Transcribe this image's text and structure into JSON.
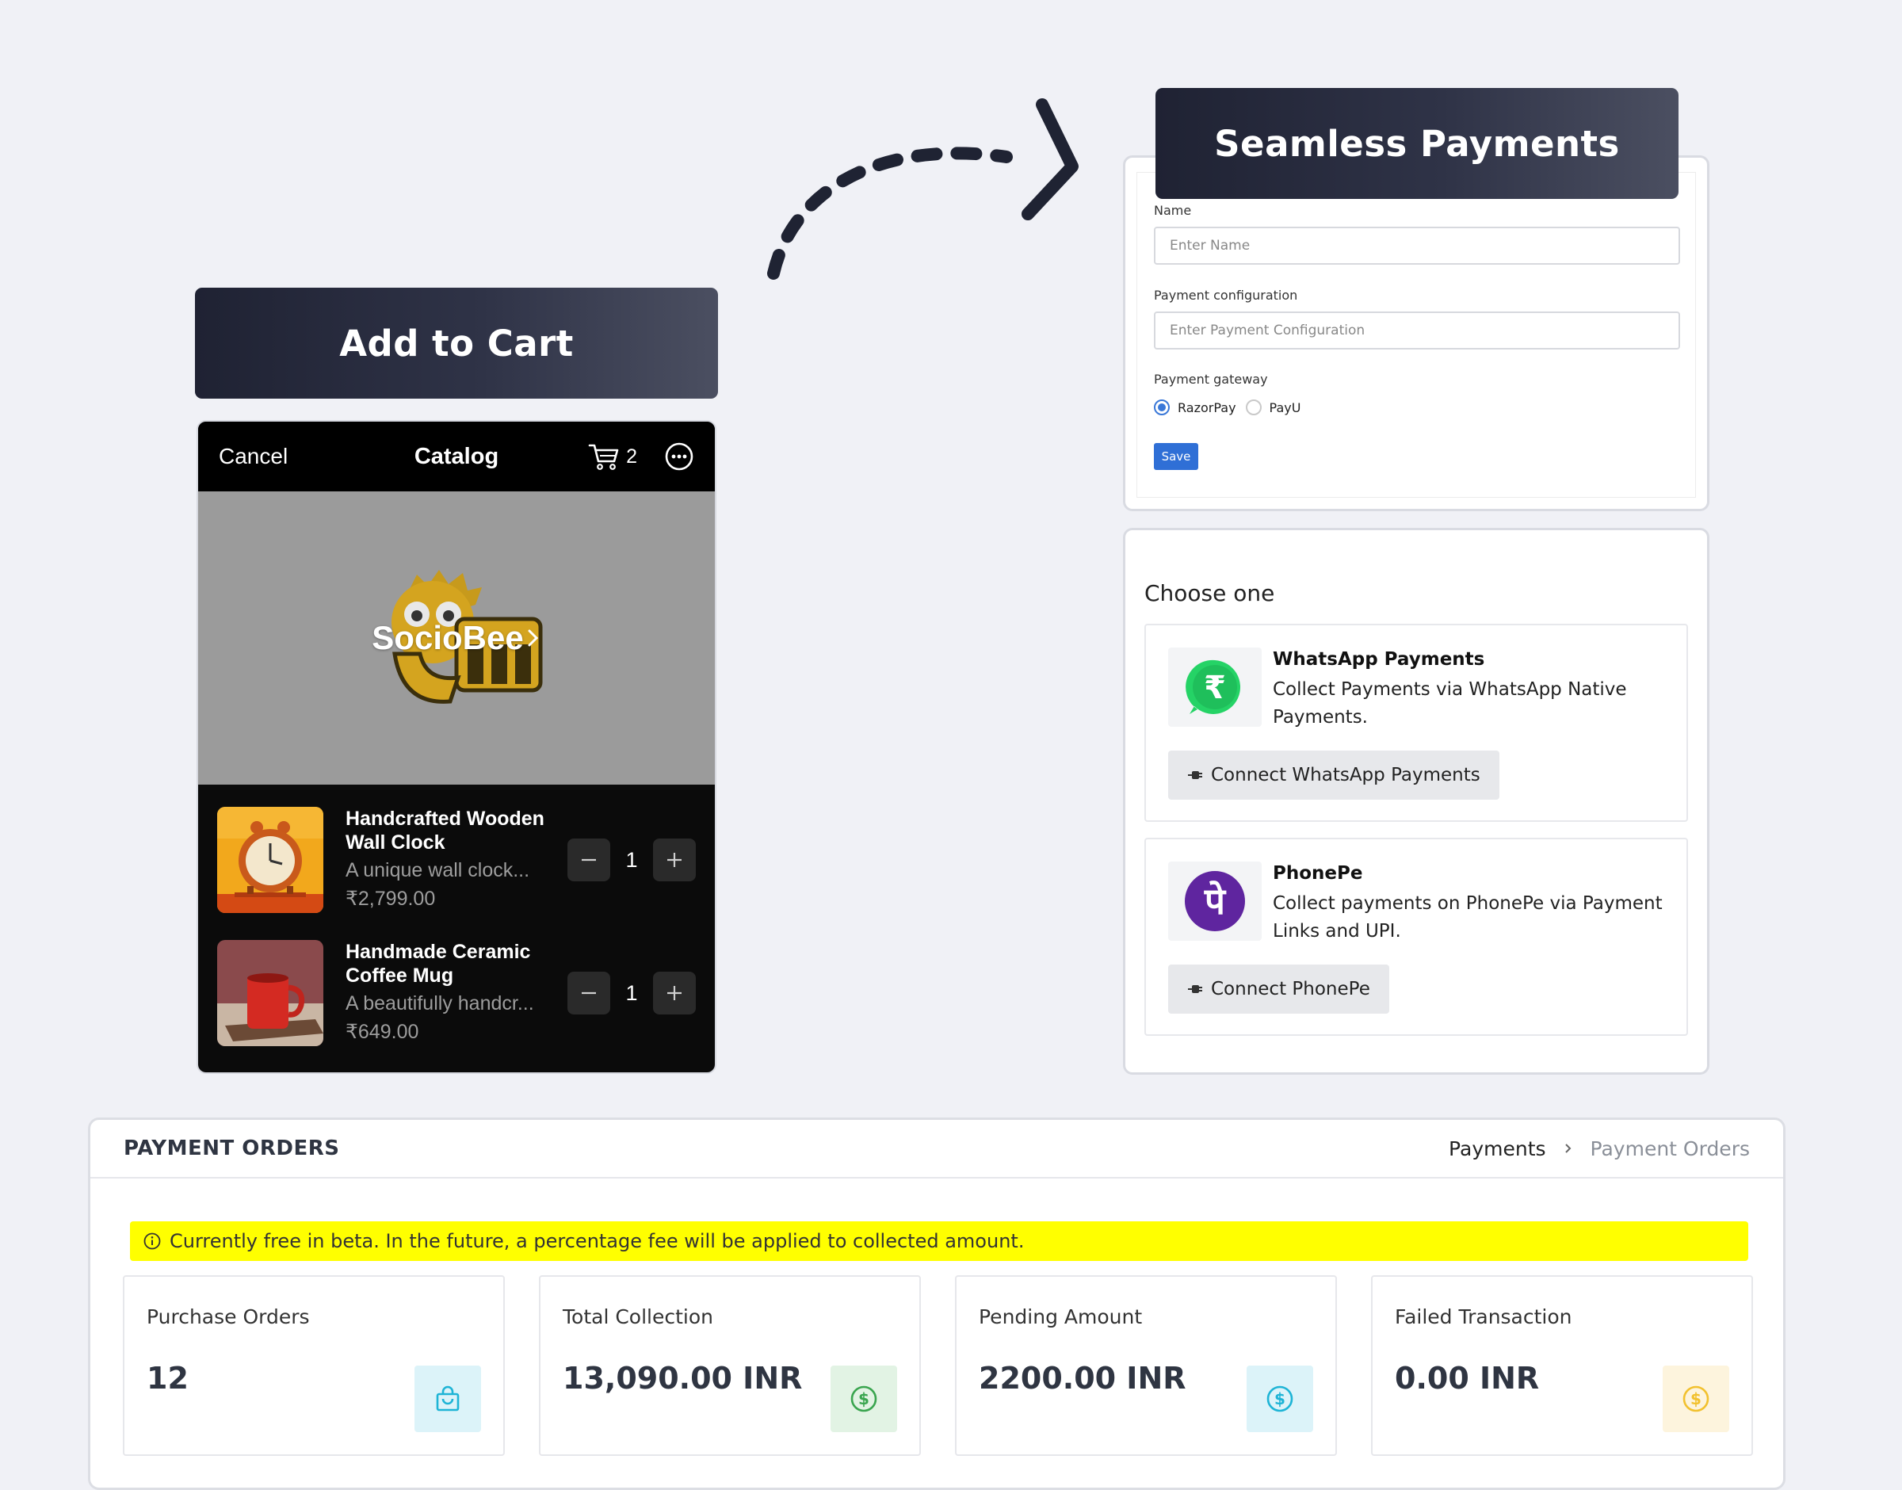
{
  "banners": {
    "cart": "Add to Cart",
    "payments": "Seamless Payments"
  },
  "catalog": {
    "cancel": "Cancel",
    "title": "Catalog",
    "cart_count": "2",
    "brand": "SocioBee",
    "products": [
      {
        "name_line1": "Handcrafted Wooden",
        "name_line2": "Wall Clock",
        "description": "A unique wall clock...",
        "price": "₹2,799.00",
        "quantity": "1"
      },
      {
        "name_line1": "Handmade Ceramic",
        "name_line2": "Coffee Mug",
        "description": "A beautifully handcr...",
        "price": "₹649.00",
        "quantity": "1"
      }
    ]
  },
  "form": {
    "name_label": "Name",
    "name_placeholder": "Enter Name",
    "config_label": "Payment configuration",
    "config_placeholder": "Enter Payment Configuration",
    "gateway_label": "Payment gateway",
    "gateway_options": [
      "RazorPay",
      "PayU"
    ],
    "gateway_selected": "RazorPay",
    "save_label": "Save"
  },
  "choose": {
    "title": "Choose one",
    "options": [
      {
        "title": "WhatsApp Payments",
        "description": "Collect Payments via WhatsApp Native Payments.",
        "button": "Connect WhatsApp Payments",
        "icon": "whatsapp-rupee-icon",
        "color": "#25d366"
      },
      {
        "title": "PhonePe",
        "description": "Collect payments on PhonePe via Payment Links and UPI.",
        "button": "Connect PhonePe",
        "icon": "phonepe-icon",
        "color": "#5f259f"
      }
    ]
  },
  "orders": {
    "title": "PAYMENT ORDERS",
    "breadcrumb": [
      "Payments",
      "Payment Orders"
    ],
    "notice": "Currently free in beta. In the future, a percentage fee will be applied to collected amount.",
    "stats": [
      {
        "label": "Purchase Orders",
        "value": "12",
        "icon": "shopping-bag-icon",
        "color": "#1eb4d6"
      },
      {
        "label": "Total Collection",
        "value": "13,090.00 INR",
        "icon": "dollar-coin-icon",
        "color": "#3aa54f"
      },
      {
        "label": "Pending Amount",
        "value": "2200.00 INR",
        "icon": "dollar-coin-icon",
        "color": "#1eb4d6"
      },
      {
        "label": "Failed Transaction",
        "value": "0.00 INR",
        "icon": "dollar-coin-icon",
        "color": "#f2c12e"
      }
    ]
  }
}
